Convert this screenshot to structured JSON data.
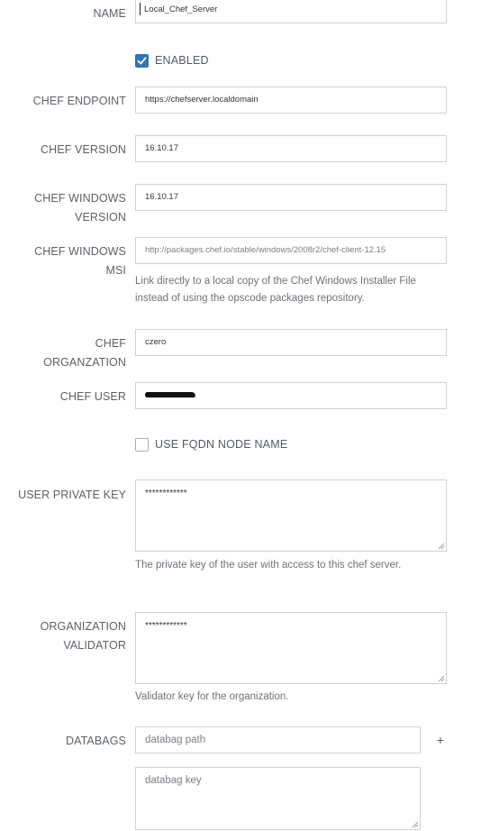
{
  "form": {
    "name": {
      "label": "NAME",
      "value": "Local_Chef_Server"
    },
    "enabled": {
      "label": "ENABLED",
      "checked": true
    },
    "chef_endpoint": {
      "label": "CHEF ENDPOINT",
      "value": "https://chefserver.localdomain"
    },
    "chef_version": {
      "label": "CHEF VERSION",
      "value": "16.10.17"
    },
    "chef_windows_version": {
      "label_line1": "CHEF WINDOWS",
      "label_line2": "VERSION",
      "value": "16.10.17"
    },
    "chef_windows_msi": {
      "label_line1": "CHEF WINDOWS",
      "label_line2": "MSI",
      "value": "http://packages.chef.io/stable/windows/2008r2/chef-client-12.15",
      "help": "Link directly to a local copy of the Chef Windows Installer File instead of using the opscode packages repository."
    },
    "chef_organization": {
      "label_line1": "CHEF",
      "label_line2": "ORGANZATION",
      "value": "czero"
    },
    "chef_user": {
      "label": "CHEF USER",
      "redacted": true
    },
    "use_fqdn": {
      "label": "USE FQDN NODE NAME",
      "checked": false
    },
    "user_private_key": {
      "label": "USER PRIVATE KEY",
      "value": "************",
      "help": "The private key of the user with access to this chef server."
    },
    "organization_validator": {
      "label_line1": "ORGANIZATION",
      "label_line2": "VALIDATOR",
      "value": "************",
      "help": "Validator key for the organization."
    },
    "databags": {
      "label": "DATABAGS",
      "path_placeholder": "databag path",
      "key_placeholder": "databag key",
      "add_label": "+"
    }
  }
}
